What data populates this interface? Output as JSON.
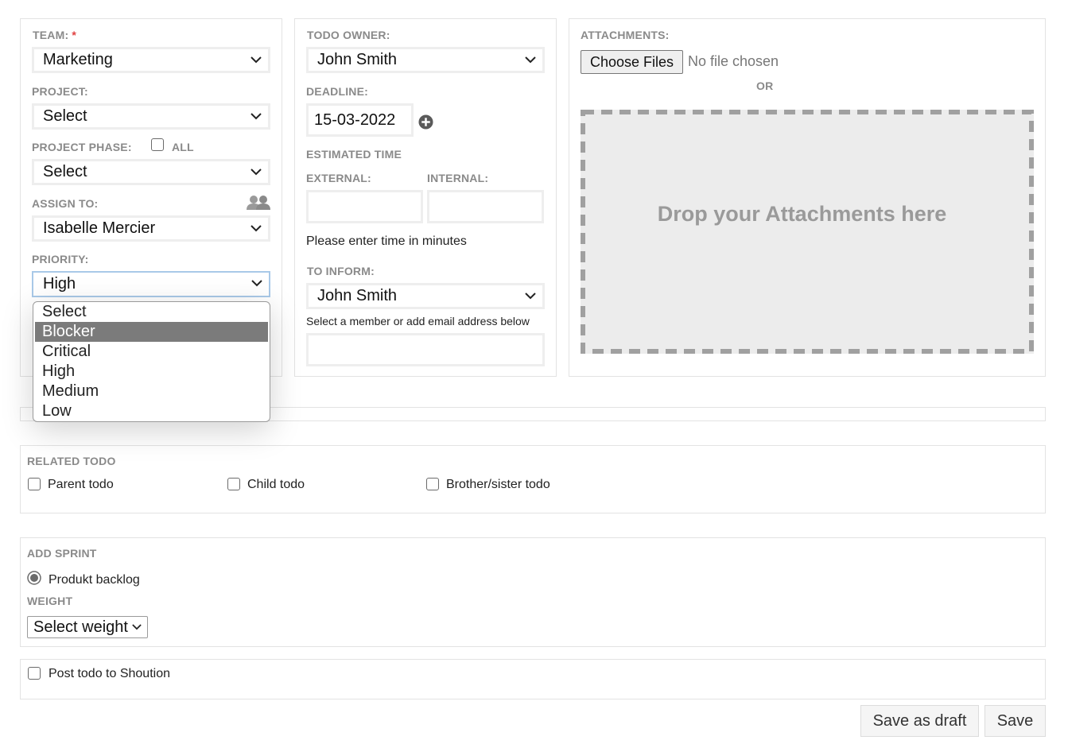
{
  "team": {
    "label": "TEAM:",
    "required_mark": "*",
    "value": "Marketing"
  },
  "project": {
    "label": "PROJECT:",
    "value": "Select"
  },
  "project_phase": {
    "label": "PROJECT PHASE:",
    "all_label": "ALL",
    "value": "Select",
    "all_checked": false
  },
  "assign_to": {
    "label": "ASSIGN TO:",
    "icon": "users-icon",
    "value": "Isabelle Mercier"
  },
  "priority": {
    "label": "PRIORITY:",
    "value": "High",
    "dropdown_open": true,
    "highlighted": "Blocker",
    "options": [
      "Select",
      "Blocker",
      "Critical",
      "High",
      "Medium",
      "Low"
    ]
  },
  "todo_owner": {
    "label": "TODO OWNER:",
    "value": "John Smith"
  },
  "deadline": {
    "label": "DEADLINE:",
    "value": "15-03-2022",
    "add_icon": "plus-circle-icon"
  },
  "estimated_time": {
    "label": "ESTIMATED TIME",
    "external_label": "EXTERNAL:",
    "internal_label": "INTERNAL:",
    "external_value": "",
    "internal_value": "",
    "hint": "Please enter time in minutes"
  },
  "to_inform": {
    "label": "TO INFORM:",
    "value": "John Smith",
    "hint": "Select a member or add email address below",
    "email_value": ""
  },
  "attachments": {
    "label": "ATTACHMENTS:",
    "choose_button": "Choose Files",
    "no_file": "No file chosen",
    "or": "OR",
    "drop_text": "Drop your Attachments here"
  },
  "related_todo": {
    "label": "RELATED TODO",
    "items": [
      {
        "label": "Parent todo",
        "checked": false
      },
      {
        "label": "Child todo",
        "checked": false
      },
      {
        "label": "Brother/sister todo",
        "checked": false
      }
    ]
  },
  "add_sprint": {
    "label": "ADD SPRINT",
    "radio_label": "Produkt backlog",
    "radio_checked": true,
    "weight_label": "WEIGHT",
    "weight_value": "Select weight"
  },
  "shoution": {
    "label": "Post todo to Shoution",
    "checked": false
  },
  "actions": {
    "save_draft": "Save as draft",
    "save": "Save"
  },
  "colors": {
    "focus_border": "#a9c9e8",
    "required": "#e04040",
    "highlight": "#7b7b7b",
    "label": "#8a8a8a"
  }
}
